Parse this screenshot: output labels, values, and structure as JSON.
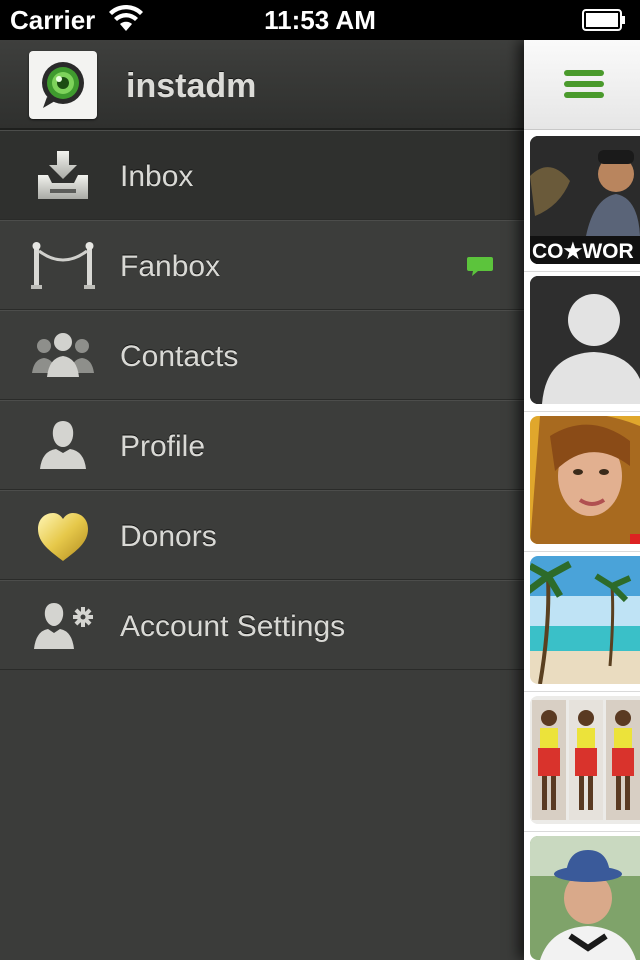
{
  "status_bar": {
    "carrier": "Carrier",
    "time": "11:53 AM"
  },
  "drawer": {
    "app_name": "instadm",
    "items": [
      {
        "label": "Inbox",
        "icon": "inbox-download-icon",
        "active": true
      },
      {
        "label": "Fanbox",
        "icon": "velvet-rope-icon",
        "badge": "green-chat-bubble-icon"
      },
      {
        "label": "Contacts",
        "icon": "contacts-group-icon"
      },
      {
        "label": "Profile",
        "icon": "person-icon"
      },
      {
        "label": "Donors",
        "icon": "gold-heart-icon"
      },
      {
        "label": "Account Settings",
        "icon": "person-gear-icon"
      }
    ]
  },
  "peek": {
    "thumb_text": "CO★WOR",
    "accent_color": "#4a9a2c"
  }
}
